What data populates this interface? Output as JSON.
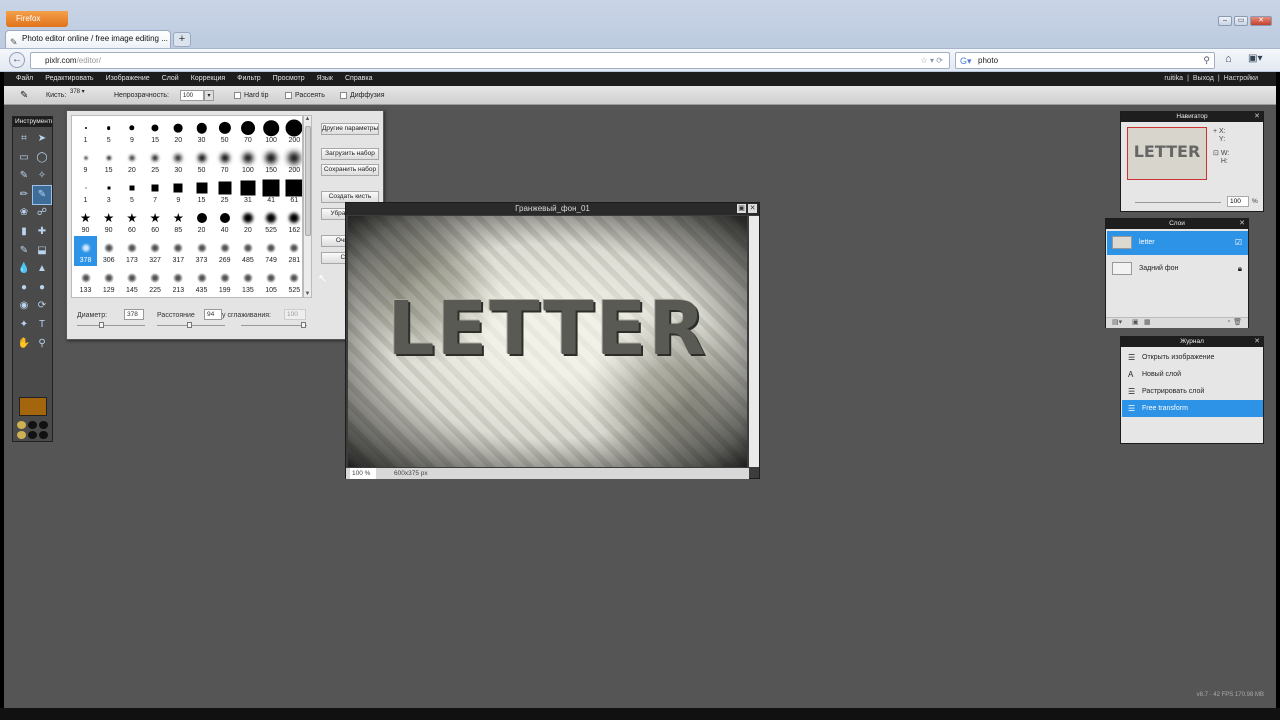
{
  "browser": {
    "firefox_label": "Firefox",
    "tab_title": "Photo editor online / free image editing ...",
    "new_tab": "+",
    "url_domain": "pixlr.com",
    "url_path": "/editor/",
    "search_value": "photo",
    "window_buttons": [
      "–",
      "▭",
      "✕"
    ]
  },
  "menu": {
    "items": [
      "Файл",
      "Редактировать",
      "Изображение",
      "Слой",
      "Коррекция",
      "Фильтр",
      "Просмотр",
      "Язык",
      "Справка"
    ],
    "user": "ruitika",
    "sep1": "|",
    "logout": "Выход",
    "sep2": "|",
    "settings": "Настройки"
  },
  "options": {
    "brush_label": "Кисть:",
    "brush_size": "378",
    "opacity_label": "Непрозрачность:",
    "opacity_value": "100",
    "hard_tip": "Hard tip",
    "scatter": "Рассеять",
    "diffuse": "Диффузия"
  },
  "tools": {
    "title": "Инструменты",
    "icons": [
      "⌗",
      "➤",
      "▭",
      "◯",
      "✎",
      "✧",
      "✏",
      "✎",
      "❀",
      "☍",
      "▮",
      "✚",
      "✎",
      "⬓",
      "💧",
      "▲",
      "●",
      "●",
      "◉",
      "⟳",
      "✦",
      "T",
      "✋",
      "⚲"
    ],
    "color": "#a4660c"
  },
  "brushes": {
    "rows": [
      [
        "1",
        "5",
        "9",
        "15",
        "20",
        "30",
        "50",
        "70",
        "100",
        "200"
      ],
      [
        "9",
        "15",
        "20",
        "25",
        "30",
        "50",
        "70",
        "100",
        "150",
        "200"
      ],
      [
        "1",
        "3",
        "5",
        "7",
        "9",
        "15",
        "25",
        "31",
        "41",
        "61"
      ],
      [
        "90",
        "90",
        "60",
        "60",
        "85",
        "20",
        "40",
        "20",
        "525",
        "162"
      ],
      [
        "378",
        "306",
        "173",
        "327",
        "317",
        "373",
        "269",
        "485",
        "749",
        "281"
      ],
      [
        "133",
        "129",
        "145",
        "225",
        "213",
        "435",
        "199",
        "135",
        "105",
        "525"
      ]
    ],
    "buttons": [
      "Другие параметры",
      "Загрузить набор",
      "Сохранить набор",
      "Создать кисть",
      "Убрать кисть",
      "Очистить",
      "Сброс"
    ],
    "diameter_label": "Диаметр:",
    "diameter_value": "378",
    "spacing_label": "Расстояние",
    "spacing_value": "94",
    "smoothing_label": "у сглаживания:",
    "smoothing_value": "100"
  },
  "image_window": {
    "title": "Гранжевый_фон_01",
    "canvas_text": "LETTER",
    "zoom": "100 %",
    "size": "600x375 px"
  },
  "navigator": {
    "title": "Навигатор",
    "x": "X:",
    "y": "Y:",
    "w": "W:",
    "h": "H:",
    "zoom": "100",
    "pct": "%",
    "thumb_text": "LETTER"
  },
  "layers": {
    "title": "Слои",
    "items": [
      {
        "name": "letter"
      },
      {
        "name": "Задний фон"
      }
    ]
  },
  "history": {
    "title": "Журнал",
    "items": [
      {
        "label": "Открыть изображение",
        "icon": "☰"
      },
      {
        "label": "Новый слой",
        "icon": "A"
      },
      {
        "label": "Растрировать слой",
        "icon": "☰"
      },
      {
        "label": "Free transform",
        "icon": "☰"
      }
    ]
  },
  "status": {
    "version": "v8.7 · 42 FPS 170.98 MB"
  },
  "colors": {
    "selection": "#2d93e6",
    "brush_color": "#a4660c"
  }
}
